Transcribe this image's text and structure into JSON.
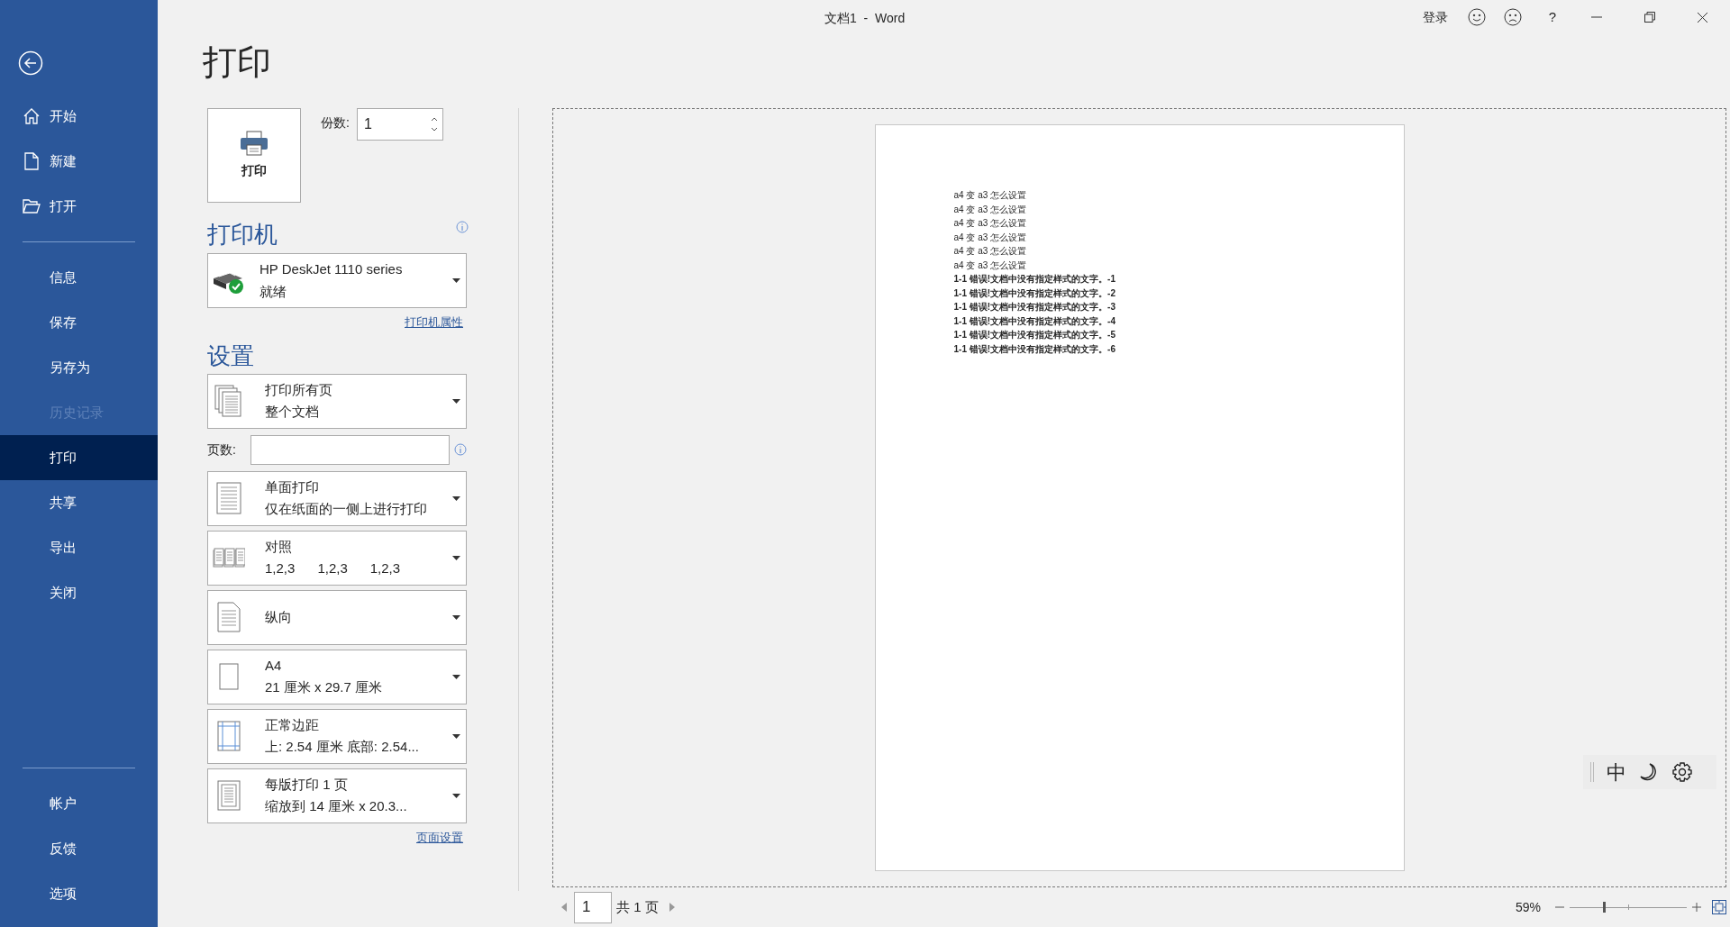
{
  "window": {
    "title": "文档1  -  Word",
    "sign_in": "登录",
    "help": "?"
  },
  "sidebar": {
    "items": [
      {
        "label": "开始",
        "kind": "home",
        "selected": false,
        "disabled": false
      },
      {
        "label": "新建",
        "kind": "new",
        "selected": false,
        "disabled": false
      },
      {
        "label": "打开",
        "kind": "open",
        "selected": false,
        "disabled": false
      },
      {
        "label": "信息",
        "kind": "plain",
        "selected": false,
        "disabled": false
      },
      {
        "label": "保存",
        "kind": "plain",
        "selected": false,
        "disabled": false
      },
      {
        "label": "另存为",
        "kind": "plain",
        "selected": false,
        "disabled": false
      },
      {
        "label": "历史记录",
        "kind": "plain",
        "selected": false,
        "disabled": true
      },
      {
        "label": "打印",
        "kind": "plain",
        "selected": true,
        "disabled": false
      },
      {
        "label": "共享",
        "kind": "plain",
        "selected": false,
        "disabled": false
      },
      {
        "label": "导出",
        "kind": "plain",
        "selected": false,
        "disabled": false
      },
      {
        "label": "关闭",
        "kind": "plain",
        "selected": false,
        "disabled": false
      }
    ],
    "bottom_items": [
      {
        "label": "帐户"
      },
      {
        "label": "反馈"
      },
      {
        "label": "选项"
      }
    ]
  },
  "heading": "打印",
  "print_button": "打印",
  "copies": {
    "label": "份数:",
    "value": "1"
  },
  "printer": {
    "heading": "打印机",
    "name": "HP DeskJet 1110 series",
    "status": "就绪",
    "link": "打印机属性"
  },
  "settings": {
    "heading": "设置",
    "pages_label": "页数:",
    "link": "页面设置",
    "options": [
      {
        "kind": "pages",
        "title": "打印所有页",
        "detail": [
          "整个文档"
        ]
      },
      {
        "kind": "field"
      },
      {
        "kind": "sides",
        "title": "单面打印",
        "detail": [
          "仅在纸面的一侧上进行打印"
        ]
      },
      {
        "kind": "collate",
        "title": "对照",
        "detail": [
          "1,2,3",
          "1,2,3",
          "1,2,3"
        ]
      },
      {
        "kind": "orientation",
        "title": "纵向"
      },
      {
        "kind": "paper",
        "title": "A4",
        "detail": [
          "21 厘米 x 29.7 厘米"
        ]
      },
      {
        "kind": "margins",
        "title": "正常边距",
        "detail": [
          "上: 2.54 厘米 底部: 2.54..."
        ]
      },
      {
        "kind": "per-sheet",
        "title": "每版打印 1 页",
        "detail": [
          "缩放到 14 厘米 x 20.3..."
        ]
      }
    ]
  },
  "preview": {
    "lines": [
      {
        "text": "a4 变 a3 怎么设置",
        "bold": false
      },
      {
        "text": "a4 变 a3 怎么设置",
        "bold": false
      },
      {
        "text": "a4 变 a3 怎么设置",
        "bold": false
      },
      {
        "text": "a4 变 a3 怎么设置",
        "bold": false
      },
      {
        "text": "a4 变 a3 怎么设置",
        "bold": false
      },
      {
        "text": "a4 变 a3 怎么设置",
        "bold": false
      },
      {
        "text": "1-1 错误!文档中没有指定样式的文字。-1",
        "bold": true
      },
      {
        "text": "1-1 错误!文档中没有指定样式的文字。-2",
        "bold": true
      },
      {
        "text": "1-1 错误!文档中没有指定样式的文字。-3",
        "bold": true
      },
      {
        "text": "1-1 错误!文档中没有指定样式的文字。-4",
        "bold": true
      },
      {
        "text": "1-1 错误!文档中没有指定样式的文字。-5",
        "bold": true
      },
      {
        "text": "1-1 错误!文档中没有指定样式的文字。-6",
        "bold": true
      }
    ]
  },
  "ime": {
    "mode": "中"
  },
  "status_bar": {
    "page": "1",
    "total": "共 1 页",
    "zoom": "59%",
    "level": 0.29
  }
}
